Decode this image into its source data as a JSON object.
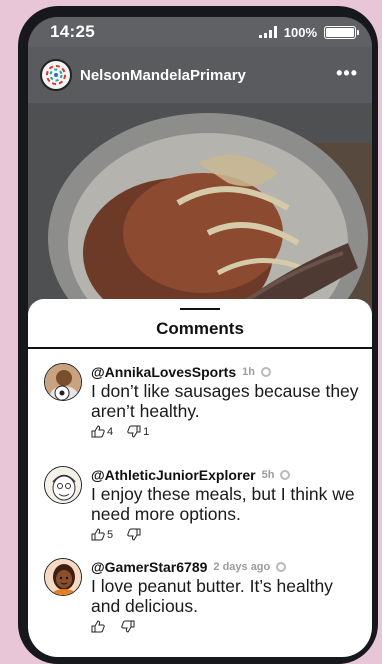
{
  "status": {
    "time": "14:25",
    "battery": "100%",
    "battery_level": 1.0
  },
  "post": {
    "account": "NelsonMandelaPrimary"
  },
  "comments_sheet": {
    "title": "Comments",
    "comments": [
      {
        "user": "@AnnikaLovesSports",
        "time": "1h",
        "text": "I don’t like sausages because they aren’t healthy.",
        "likes": "4",
        "dislikes": "1"
      },
      {
        "user": "@AthleticJuniorExplorer",
        "time": "5h",
        "text": "I enjoy these meals, but I think we need more options.",
        "likes": "5",
        "dislikes": ""
      },
      {
        "user": "@GamerStar6789",
        "time": "2 days ago",
        "text": "I love peanut butter. It’s healthy and delicious.",
        "likes": "",
        "dislikes": ""
      }
    ]
  }
}
